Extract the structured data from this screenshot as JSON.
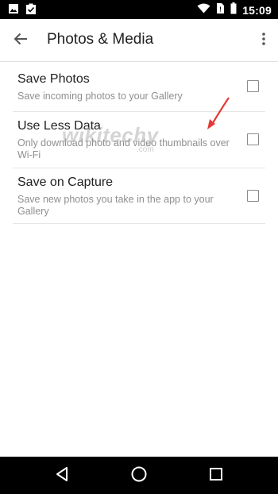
{
  "status_bar": {
    "time": "15:09",
    "left_icons": [
      "image-icon",
      "clipboard-check-icon"
    ],
    "right_icons": [
      "wifi-icon",
      "no-sim-icon",
      "battery-icon"
    ]
  },
  "app_bar": {
    "title": "Photos & Media",
    "back_icon": "arrow-back-icon",
    "menu_icon": "more-vert-icon"
  },
  "settings": [
    {
      "title": "Save Photos",
      "summary": "Save incoming photos to your Gallery",
      "checked": false
    },
    {
      "title": "Use Less Data",
      "summary": "Only download photo and video thumbnails over Wi-Fi",
      "checked": false
    },
    {
      "title": "Save on Capture",
      "summary": "Save new photos you take in the app to your Gallery",
      "checked": false
    }
  ],
  "watermark": {
    "text": "wikitechy",
    "sub": ".com"
  },
  "annotation": {
    "color": "#e53935"
  },
  "nav_bar": {
    "icons": [
      "back-triangle-icon",
      "home-circle-icon",
      "recents-square-icon"
    ]
  },
  "colors": {
    "status_bar": "#000000",
    "nav_bar": "#000000",
    "title_text": "#212121",
    "summary_text": "#8f8f8f",
    "divider": "#e6e6e6"
  }
}
